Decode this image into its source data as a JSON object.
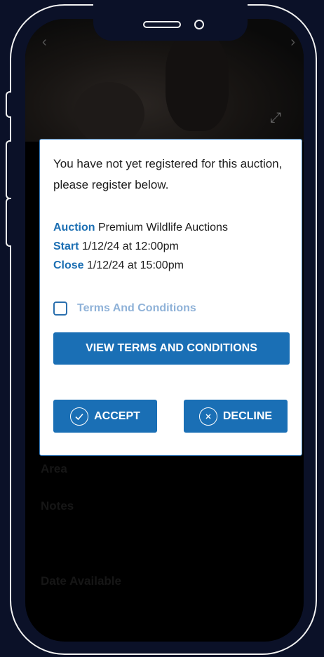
{
  "background": {
    "labels": [
      "Area",
      "Notes",
      "Date Available"
    ]
  },
  "modal": {
    "message": "You have not yet registered for this auction, please register below.",
    "auction_label": "Auction",
    "auction_value": "Premium Wildlife Auctions",
    "start_label": "Start",
    "start_value": "1/12/24 at 12:00pm",
    "close_label": "Close",
    "close_value": "1/12/24 at 15:00pm",
    "terms_checkbox_label": "Terms And Conditions",
    "terms_checked": false,
    "view_terms_label": "VIEW TERMS AND CONDITIONS",
    "accept_label": "ACCEPT",
    "decline_label": "DECLINE"
  },
  "colors": {
    "accent": "#1a6fb5",
    "key_text": "#1c6fb3",
    "terms_label": "#8fb2d8",
    "frame": "#0b1128"
  },
  "icons": {
    "prev": "chevron-left-icon",
    "next": "chevron-right-icon",
    "expand": "expand-icon",
    "accept": "check-circle-icon",
    "decline": "close-circle-icon"
  }
}
